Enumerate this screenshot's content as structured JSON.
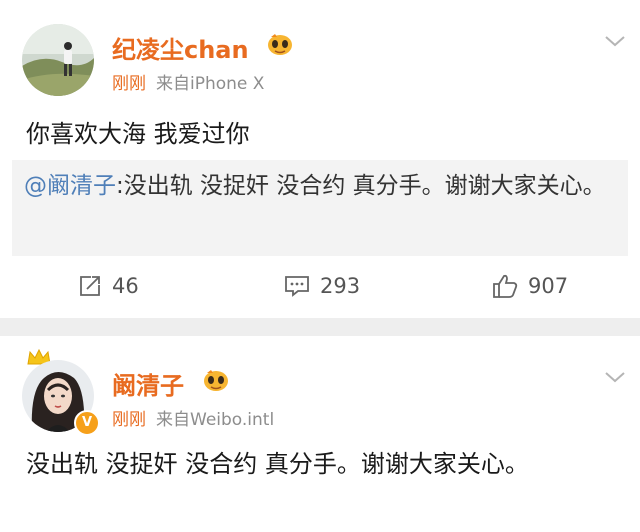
{
  "post1": {
    "author": "纪凌尘chan",
    "time": "刚刚",
    "source": "来自iPhone X",
    "content": "你喜欢大海 我爱过你",
    "retweet": {
      "mention": "@阚清子",
      "text": ":没出轨 没捉奸 没合约 真分手。谢谢大家关心。"
    },
    "actions": {
      "repost_count": "46",
      "comment_count": "293",
      "like_count": "907"
    }
  },
  "post2": {
    "author": "阚清子",
    "time": "刚刚",
    "source": "来自Weibo.intl",
    "content": "没出轨 没捉奸 没合约 真分手。谢谢大家关心。",
    "verified_badge": "V"
  },
  "icons": {
    "vip": "vip-emoji-icon",
    "chevron": "chevron-down-icon",
    "repost": "repost-icon",
    "comment": "comment-icon",
    "like": "thumbs-up-icon",
    "crown": "crown-icon"
  },
  "colors": {
    "name_orange": "#e86b20",
    "mention_blue": "#4f7fb8",
    "meta_gray": "#8d8d8d",
    "retweet_bg": "#f3f3f3",
    "separator_bg": "#eeeeee"
  }
}
